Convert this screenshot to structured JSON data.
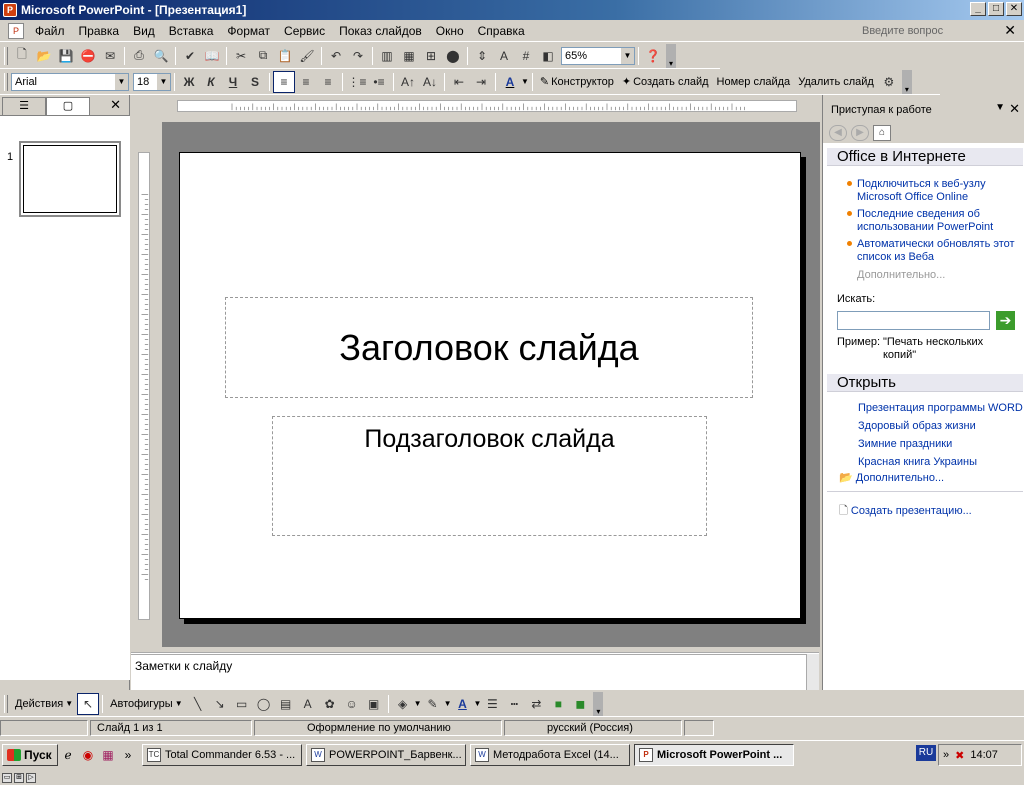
{
  "window": {
    "title": "Microsoft PowerPoint - [Презентация1]",
    "min": "_",
    "max": "□",
    "close": "✕"
  },
  "menu": {
    "items": [
      "Файл",
      "Правка",
      "Вид",
      "Вставка",
      "Формат",
      "Сервис",
      "Показ слайдов",
      "Окно",
      "Справка"
    ],
    "help_placeholder": "Введите вопрос",
    "doc_close": "✕"
  },
  "standard_toolbar": {
    "zoom": "65%"
  },
  "format_toolbar": {
    "font": "Arial",
    "size": "18",
    "bold": "Ж",
    "italic": "К",
    "underline": "Ч",
    "shadow": "S",
    "font_color": "A",
    "designer": "Конструктор",
    "new_slide": "Создать слайд",
    "slide_number": "Номер слайда",
    "delete_slide": "Удалить слайд"
  },
  "left_panel": {
    "close": "✕",
    "slide_number": "1"
  },
  "slide": {
    "title": "Заголовок слайда",
    "subtitle": "Подзаголовок слайда"
  },
  "notes": {
    "placeholder": "Заметки к слайду"
  },
  "task_pane": {
    "header": "Приступая к работе",
    "close": "✕",
    "section_online": "Office в Интернете",
    "online_links": [
      "Подключиться к веб-узлу Microsoft Office Online",
      "Последние сведения об использовании PowerPoint",
      "Автоматически обновлять этот список из Веба"
    ],
    "more_disabled": "Дополнительно...",
    "search_label": "Искать:",
    "example_label": "Пример:",
    "example_value": "\"Печать нескольких копий\"",
    "section_open": "Открыть",
    "open_files": [
      "Презентация программы WORD",
      "Здоровый образ жизни",
      "Зимние праздники",
      "Красная книга Украины"
    ],
    "more": "Дополнительно...",
    "create": "Создать презентацию..."
  },
  "draw_toolbar": {
    "actions": "Действия",
    "autoshapes": "Автофигуры"
  },
  "status": {
    "slide": "Слайд 1 из 1",
    "design": "Оформление по умолчанию",
    "language": "русский (Россия)"
  },
  "taskbar": {
    "start": "Пуск",
    "tasks": [
      "Total Commander 6.53 - ...",
      "POWERPOINT_Барвенк...",
      "Методработа Excel (14...",
      "Microsoft PowerPoint ..."
    ],
    "lang": "RU",
    "clock": "14:07",
    "chevron": "»"
  }
}
